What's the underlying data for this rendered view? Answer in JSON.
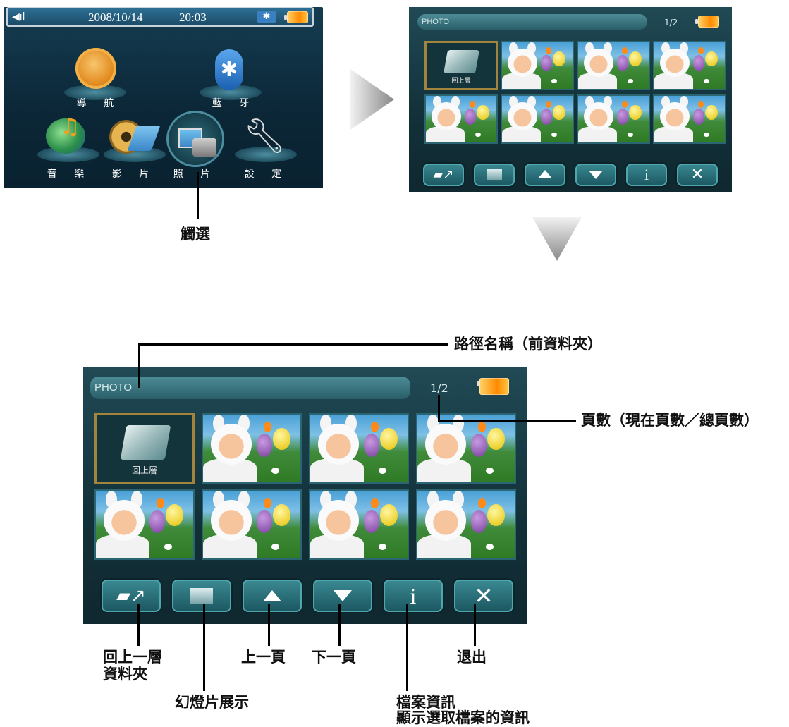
{
  "menu_screen": {
    "status": {
      "volume_icon": "speaker-icon",
      "date": "2008/10/14",
      "time": "20:03",
      "bluetooth_icon": "bluetooth-icon",
      "battery_icon": "battery-icon"
    },
    "items": [
      {
        "label": "導 航",
        "icon": "navigation-icon"
      },
      {
        "label": "藍 牙",
        "icon": "bluetooth-icon"
      },
      {
        "label": "音 樂",
        "icon": "music-icon"
      },
      {
        "label": "影 片",
        "icon": "video-icon"
      },
      {
        "label": "照 片",
        "icon": "photo-icon"
      },
      {
        "label": "設 定",
        "icon": "settings-icon"
      }
    ],
    "touch_callout": "觸選"
  },
  "photo_screen_small": {
    "path": "PHOTO",
    "page": "1/2",
    "folder_label": "回上層"
  },
  "photo_screen_large": {
    "path": "PHOTO",
    "page": "1/2",
    "folder_label": "回上層"
  },
  "toolbar_icons": [
    "folder-up-icon",
    "slideshow-icon",
    "arrow-up-icon",
    "arrow-down-icon",
    "info-icon",
    "close-icon"
  ],
  "callouts": {
    "path_name": "路徑名稱（前資料夾）",
    "page_count": "頁數（現在頁數／總頁數）",
    "up_folder_1": "回上一層",
    "up_folder_2": "資料夾",
    "slideshow": "幻燈片展示",
    "prev_page": "上一頁",
    "next_page": "下一頁",
    "file_info_1": "檔案資訊",
    "file_info_2": "顯示選取檔案的資訊",
    "exit": "退出"
  },
  "colors": {
    "screen_bg": "#10282f",
    "accent_gold": "#a3843d",
    "battery": "#ff8a00"
  }
}
